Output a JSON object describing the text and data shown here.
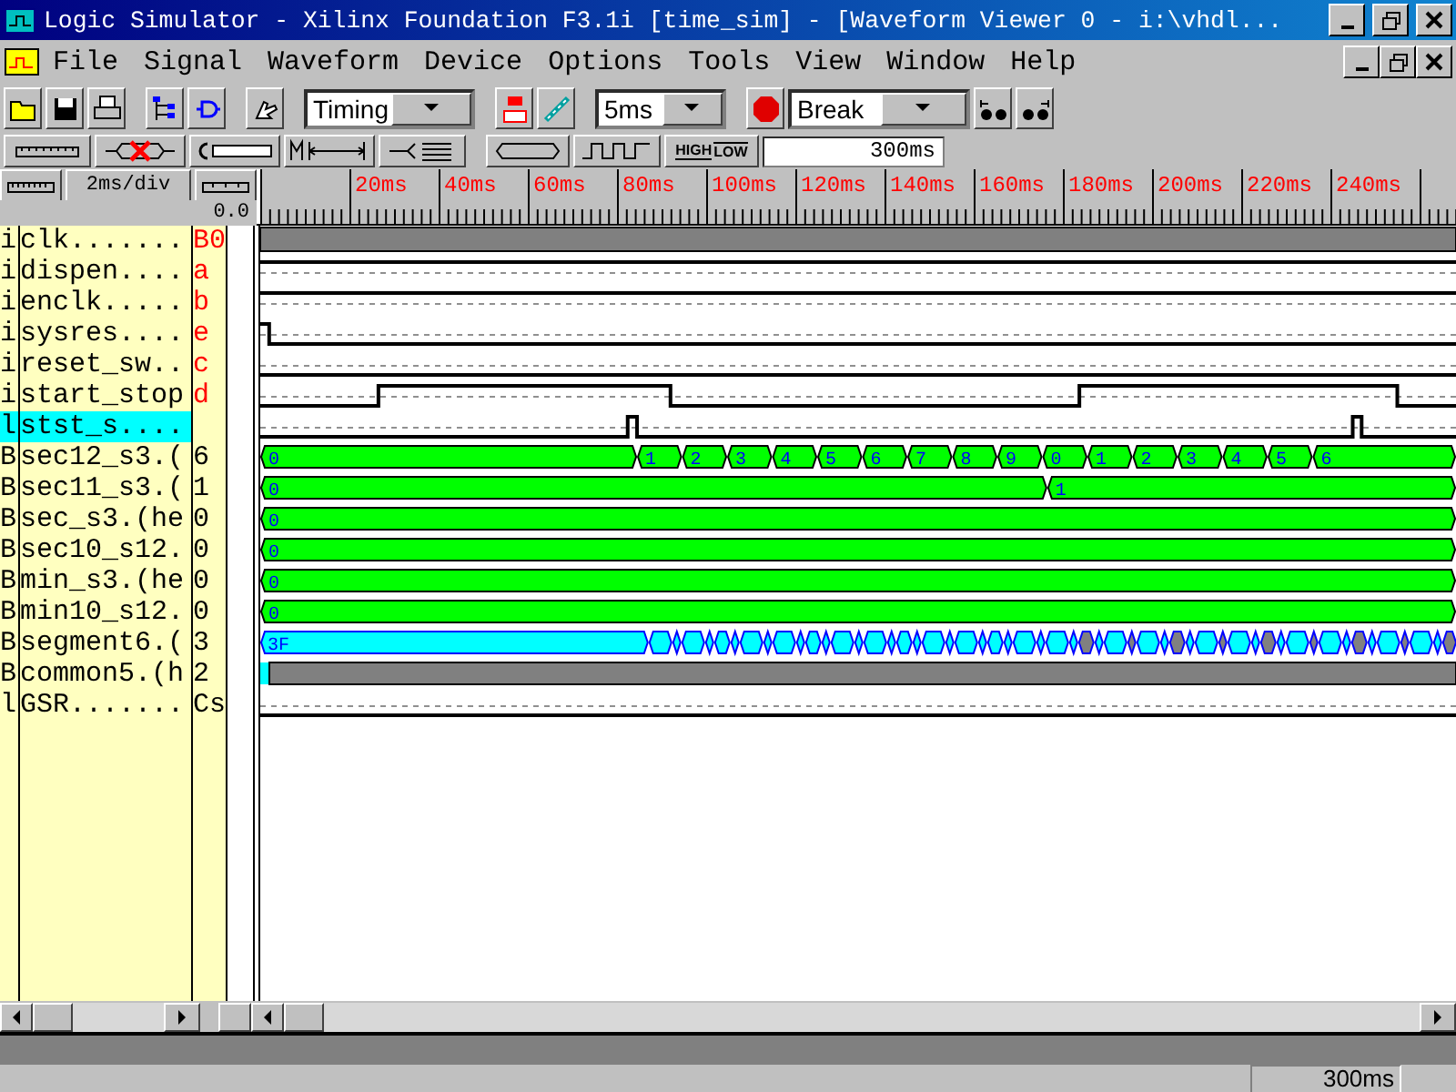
{
  "window": {
    "title": "Logic Simulator - Xilinx Foundation F3.1i [time_sim] - [Waveform Viewer 0  -  i:\\vhdl..."
  },
  "menu": [
    "File",
    "Signal",
    "Waveform",
    "Device",
    "Options",
    "Tools",
    "View",
    "Window",
    "Help"
  ],
  "toolbar": {
    "mode": "Timing",
    "step": "5ms",
    "break_mode": "Break"
  },
  "toolbar2": {
    "high_label": "HIGH",
    "low_label": "LOW",
    "time": "300ms"
  },
  "scale": {
    "division": "2ms/div",
    "cursor": "0.0"
  },
  "ruler": {
    "labels": [
      "20ms",
      "40ms",
      "60ms",
      "80ms",
      "100ms",
      "120ms",
      "140ms",
      "160ms",
      "180ms",
      "200ms",
      "220ms",
      "240ms"
    ]
  },
  "signals": [
    {
      "type": "i",
      "name": "clk.......",
      "value": "B0",
      "input": true,
      "kind": "clock",
      "selected": false
    },
    {
      "type": "i",
      "name": "dispen....",
      "value": "a",
      "input": true,
      "kind": "bit",
      "selected": false
    },
    {
      "type": "i",
      "name": "enclk.....",
      "value": "b",
      "input": true,
      "kind": "bit",
      "selected": false
    },
    {
      "type": "i",
      "name": "sysres....",
      "value": "e",
      "input": true,
      "kind": "bit",
      "selected": false
    },
    {
      "type": "i",
      "name": "reset_sw..",
      "value": "c",
      "input": true,
      "kind": "bit",
      "selected": false
    },
    {
      "type": "i",
      "name": "start_stop",
      "value": "d",
      "input": true,
      "kind": "bit",
      "selected": false
    },
    {
      "type": "l",
      "name": "stst_s....",
      "input": false,
      "kind": "bit",
      "selected": true
    },
    {
      "type": "B",
      "name": "sec12_s3.(",
      "value": "6",
      "input": false,
      "kind": "bus",
      "color": "#00ff00",
      "selected": false,
      "segments": [
        {
          "label": "0"
        },
        {
          "label": "1"
        },
        {
          "label": "2"
        },
        {
          "label": "3"
        },
        {
          "label": "4"
        },
        {
          "label": "5"
        },
        {
          "label": "6"
        },
        {
          "label": "7"
        },
        {
          "label": "8"
        },
        {
          "label": "9"
        },
        {
          "label": "0"
        },
        {
          "label": "1"
        },
        {
          "label": "2"
        },
        {
          "label": "3"
        },
        {
          "label": "4"
        },
        {
          "label": "5"
        },
        {
          "label": "6"
        }
      ]
    },
    {
      "type": "B",
      "name": "sec11_s3.(",
      "value": "1",
      "input": false,
      "kind": "bus",
      "color": "#00ff00",
      "selected": false,
      "segments": [
        {
          "label": "0"
        },
        {
          "label": "1"
        }
      ]
    },
    {
      "type": "B",
      "name": "sec_s3.(he",
      "value": "0",
      "input": false,
      "kind": "bus",
      "color": "#00ff00",
      "selected": false,
      "segments": [
        {
          "label": "0"
        }
      ]
    },
    {
      "type": "B",
      "name": "sec10_s12.",
      "value": "0",
      "input": false,
      "kind": "bus",
      "color": "#00ff00",
      "selected": false,
      "segments": [
        {
          "label": "0"
        }
      ]
    },
    {
      "type": "B",
      "name": "min_s3.(he",
      "value": "0",
      "input": false,
      "kind": "bus",
      "color": "#00ff00",
      "selected": false,
      "segments": [
        {
          "label": "0"
        }
      ]
    },
    {
      "type": "B",
      "name": "min10_s12.",
      "value": "0",
      "input": false,
      "kind": "bus",
      "color": "#00ff00",
      "selected": false,
      "segments": [
        {
          "label": "0"
        }
      ]
    },
    {
      "type": "B",
      "name": "segment6.(",
      "value": "3",
      "input": false,
      "kind": "toggling",
      "color": "#00ffff",
      "selected": false,
      "segments": [
        {
          "label": "3F"
        }
      ]
    },
    {
      "type": "B",
      "name": "common5.(h",
      "value": "2",
      "input": false,
      "kind": "undefined",
      "color": "#808080",
      "selected": false
    },
    {
      "type": "l",
      "name": "GSR.......",
      "value": "Cs",
      "input": false,
      "kind": "bit",
      "selected": false
    }
  ],
  "status_bar": {
    "time": "300ms"
  }
}
